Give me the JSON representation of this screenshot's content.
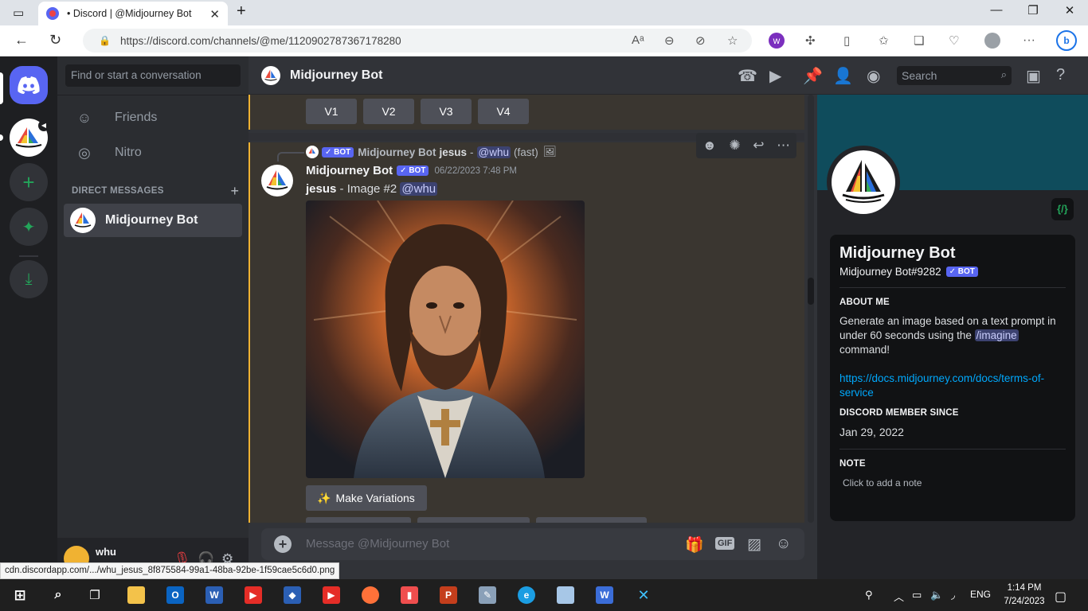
{
  "browser": {
    "tab_title": "• Discord | @Midjourney Bot",
    "url": "https://discord.com/channels/@me/1120902787367178280",
    "status_url": "cdn.discordapp.com/.../whu_jesus_8f875584-99a1-48ba-92be-1f59cae5c6d0.png",
    "read_aloud": "Aᵃ"
  },
  "sidebar": {
    "search_placeholder": "Find or start a conversation",
    "friends": "Friends",
    "nitro": "Nitro",
    "dm_header": "DIRECT MESSAGES",
    "dm_item": "Midjourney Bot",
    "user_name": "whu"
  },
  "header": {
    "title": "Midjourney Bot",
    "search_placeholder": "Search"
  },
  "messages": {
    "variation_buttons": [
      "V1",
      "V2",
      "V3",
      "V4"
    ],
    "reply_author": "Midjourney Bot",
    "reply_prompt": "jesus",
    "reply_dash": "-",
    "reply_mention": "@whu",
    "reply_mode": "(fast)",
    "author": "Midjourney Bot",
    "badge": "✓ BOT",
    "timestamp": "06/22/2023 7:48 PM",
    "body_prompt": "jesus",
    "body_text": " - Image #2 ",
    "body_mention": "@whu",
    "make_variations": "Make Variations"
  },
  "composer": {
    "placeholder": "Message @Midjourney Bot",
    "gif_label": "GIF"
  },
  "profile": {
    "name": "Midjourney Bot",
    "tag": "Midjourney Bot#9282",
    "badge": "✓ BOT",
    "about_header": "ABOUT ME",
    "about_text_1": "Generate an image based on a text prompt in under 60 seconds using the ",
    "about_cmd": "/imagine",
    "about_text_2": " command!",
    "link": "https://docs.midjourney.com/docs/terms-of-service",
    "member_header": "DISCORD MEMBER SINCE",
    "member_since": "Jan 29, 2022",
    "note_header": "NOTE",
    "note_placeholder": "Click to add a note",
    "code_badge": "{/}"
  },
  "taskbar": {
    "lang": "ENG",
    "time": "1:14 PM",
    "date": "7/24/2023"
  },
  "colors": {
    "blurple": "#5865f2",
    "bg_chat": "#313338",
    "highlight_border": "#f0b232",
    "link": "#00a8fc"
  }
}
